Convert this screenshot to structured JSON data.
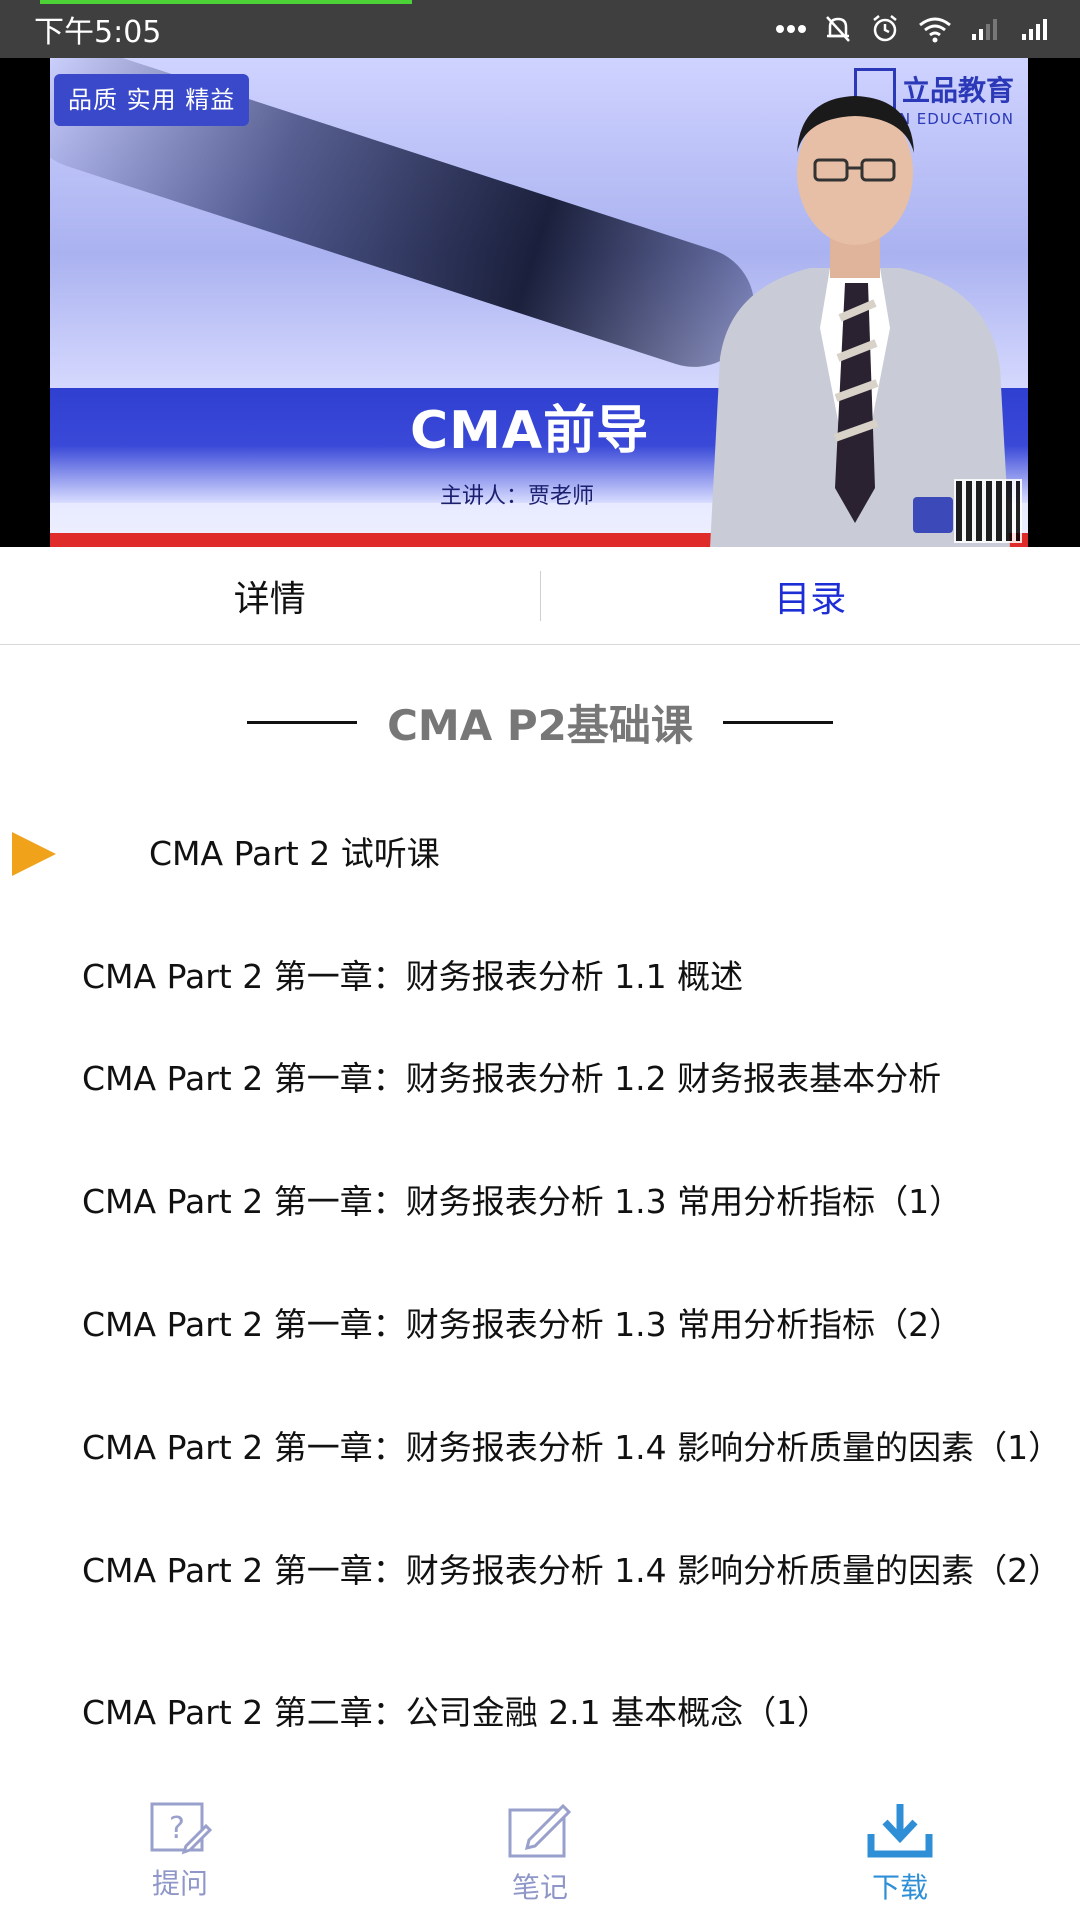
{
  "status_bar": {
    "time": "下午5:05",
    "icons": [
      "more-dots-icon",
      "mute-bell-icon",
      "alarm-icon",
      "wifi-icon",
      "signal-icon",
      "signal-icon"
    ]
  },
  "video": {
    "badge": "品质 实用 精益",
    "brand_cn": "立品教育",
    "brand_en": "IN EDUCATION",
    "title": "CMA前导",
    "lecturer": "主讲人：贾老师"
  },
  "tabs": [
    {
      "label": "详情",
      "active": false
    },
    {
      "label": "目录",
      "active": true
    }
  ],
  "section": {
    "title": "CMA P2基础课"
  },
  "lessons": [
    "CMA Part  2 试听课",
    "CMA Part 2 第一章：财务报表分析 1.1 概述",
    "CMA Part 2 第一章：财务报表分析 1.2 财务报表基本分析",
    "CMA Part 2 第一章：财务报表分析 1.3 常用分析指标（1）",
    "CMA Part 2 第一章：财务报表分析 1.3 常用分析指标（2）",
    "CMA Part 2 第一章：财务报表分析 1.4 影响分析质量的因素（1）",
    "CMA Part 2 第一章：财务报表分析 1.4 影响分析质量的因素（2）",
    "CMA Part 2 第二章：公司金融 2.1 基本概念（1）"
  ],
  "bottom_nav": [
    {
      "label": "提问",
      "icon": "question-icon"
    },
    {
      "label": "笔记",
      "icon": "note-edit-icon"
    },
    {
      "label": "下载",
      "icon": "download-icon"
    }
  ],
  "colors": {
    "accent_blue": "#1e2ed6",
    "play_orange": "#f0a21b",
    "nav_gray": "#8f96c8",
    "nav_blue": "#2f8fd6"
  }
}
